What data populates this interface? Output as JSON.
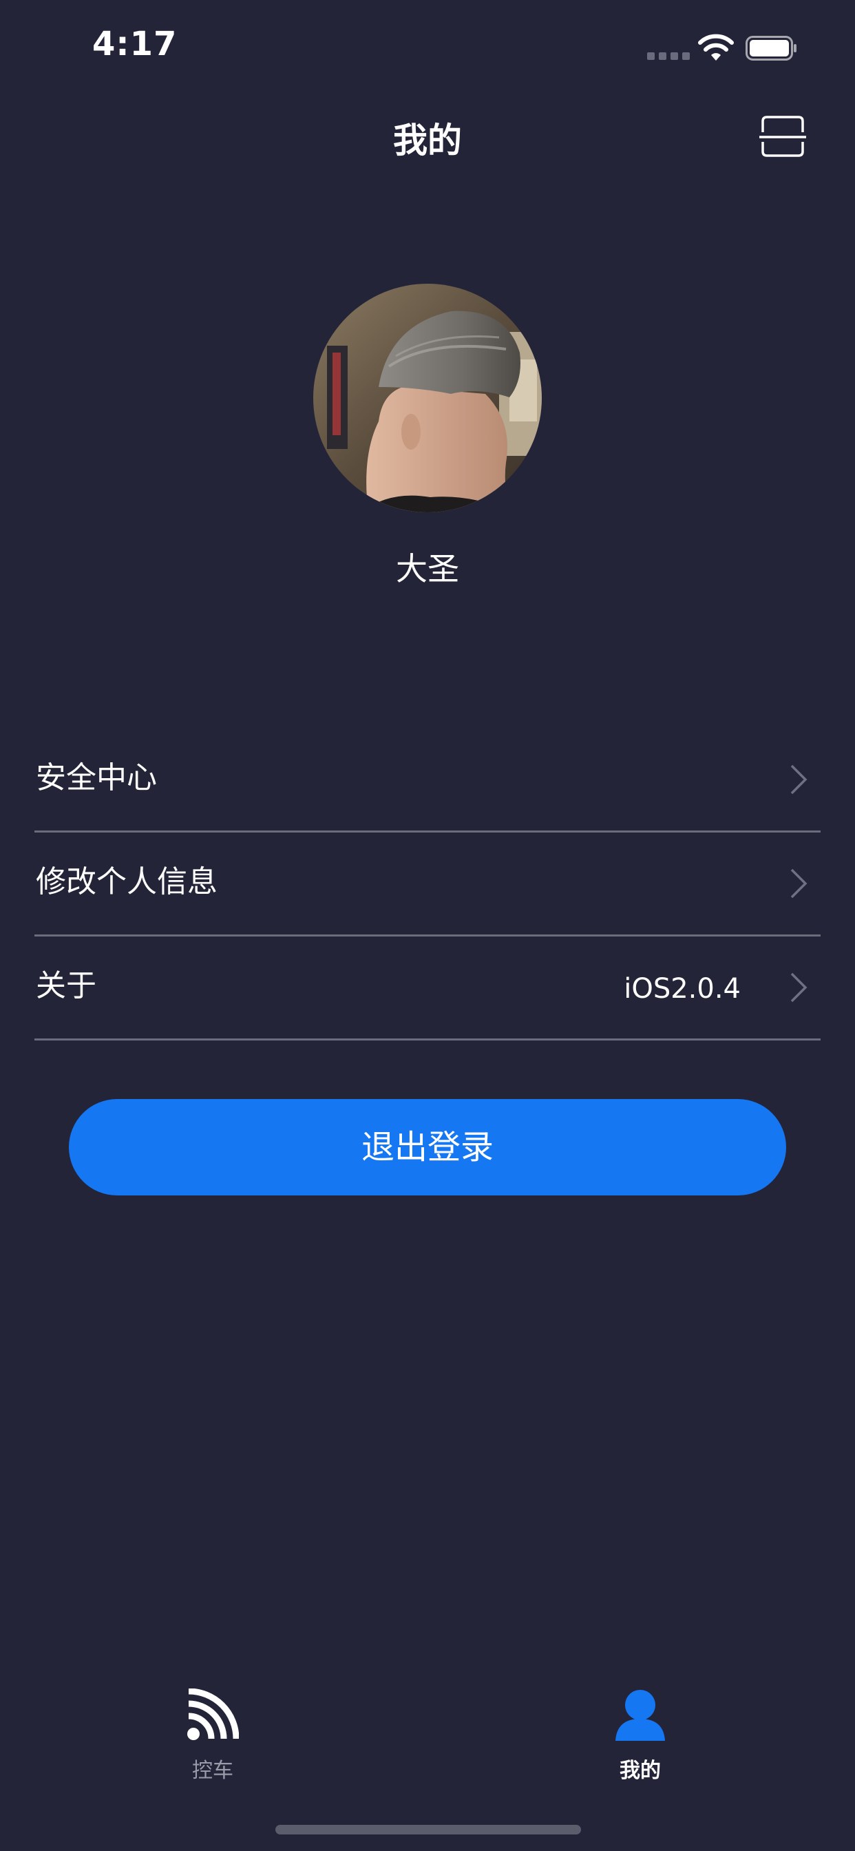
{
  "status_bar": {
    "time": "4:17"
  },
  "header": {
    "title": "我的",
    "scan_icon": "scan-icon"
  },
  "profile": {
    "avatar_icon": "avatar-photo",
    "name": "大圣"
  },
  "menu": {
    "items": [
      {
        "label": "安全中心",
        "value": ""
      },
      {
        "label": "修改个人信息",
        "value": ""
      },
      {
        "label": "关于",
        "value": "iOS2.0.4"
      }
    ]
  },
  "logout": {
    "label": "退出登录",
    "color": "#1677f2"
  },
  "tabbar": {
    "tabs": [
      {
        "label": "控车",
        "icon": "signal-icon",
        "active": false
      },
      {
        "label": "我的",
        "icon": "person-icon",
        "active": true
      }
    ],
    "active_color": "#1677f2"
  },
  "theme": {
    "background": "#232438",
    "divider": "#6b6d7d"
  }
}
